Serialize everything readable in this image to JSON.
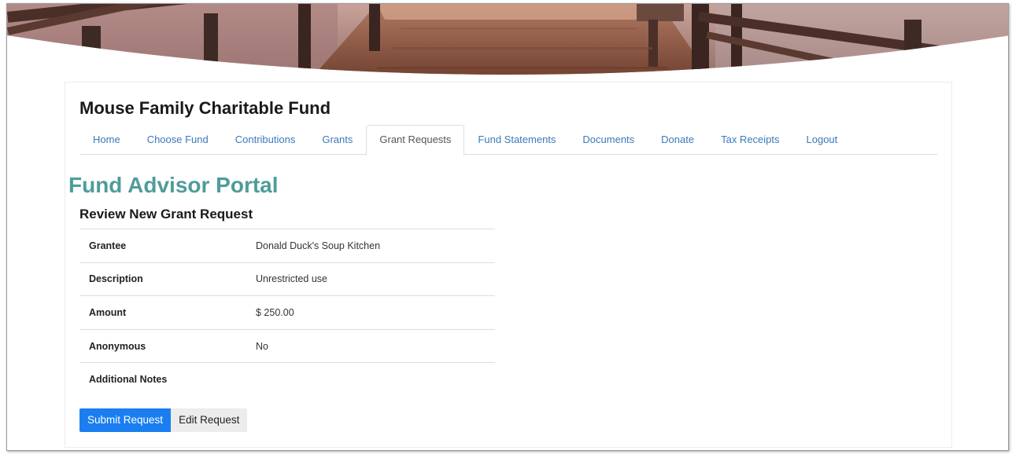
{
  "site": {
    "title": "Mouse Family Charitable Fund"
  },
  "nav": {
    "items": [
      {
        "label": "Home"
      },
      {
        "label": "Choose Fund"
      },
      {
        "label": "Contributions"
      },
      {
        "label": "Grants"
      },
      {
        "label": "Grant Requests",
        "active": true
      },
      {
        "label": "Fund Statements"
      },
      {
        "label": "Documents"
      },
      {
        "label": "Donate"
      },
      {
        "label": "Tax Receipts"
      },
      {
        "label": "Logout"
      }
    ]
  },
  "portal": {
    "title": "Fund Advisor Portal"
  },
  "review": {
    "title": "Review New Grant Request",
    "rows": [
      {
        "label": "Grantee",
        "value": "Donald Duck's Soup Kitchen"
      },
      {
        "label": "Description",
        "value": "Unrestricted use"
      },
      {
        "label": "Amount",
        "value": "$ 250.00"
      },
      {
        "label": "Anonymous",
        "value": "No"
      },
      {
        "label": "Additional Notes",
        "value": ""
      }
    ]
  },
  "actions": {
    "submit_label": "Submit Request",
    "edit_label": "Edit Request"
  },
  "colors": {
    "link": "#3b79b9",
    "portal_title": "#4f9c9a",
    "primary_button": "#1a7ef0"
  }
}
